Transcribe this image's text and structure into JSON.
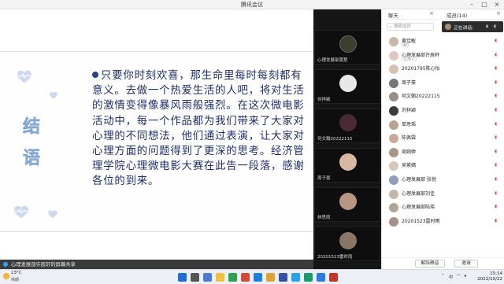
{
  "window": {
    "title": "腾讯会议"
  },
  "slide": {
    "vertical_title": [
      "结",
      "语"
    ],
    "paragraph": "只要你时刻欢喜，那生命里每时每刻都有意义。去做一个热爱生活的人吧，将对生活的激情变得像暴风雨般强烈。在这次微电影活动中，每一个作品都为我们带来了大家对心理的不同想法，他们通过表演，让大家对心理方面的问题得到了更深的思考。经济管理学院心理微电影大赛在此告一段落，感谢各位的到来。"
  },
  "share_bar": {
    "label": "心理发展部许辰轩的屏幕共享"
  },
  "videos": [
    {
      "name": "心理发展部黄楚"
    },
    {
      "name": "刘祥颖"
    },
    {
      "name": "何文翰20222115"
    },
    {
      "name": "周子豪"
    },
    {
      "name": "林思雨"
    },
    {
      "name": "20201523雷时雨"
    }
  ],
  "panel": {
    "tab_chat": "聊天",
    "tab_members": "成员(14)",
    "search_placeholder": "搜索成员",
    "speaking_label": "正在讲话:",
    "members": [
      {
        "name": "黄佳敏",
        "sub": "(我)"
      },
      {
        "name": "心理发展部许辰轩",
        "sub": "(主持人)"
      },
      {
        "name": "20201795陈心怡",
        "sub": ""
      },
      {
        "name": "周子豪",
        "sub": ""
      },
      {
        "name": "何文翰20222115",
        "sub": ""
      },
      {
        "name": "刘祥颖",
        "sub": ""
      },
      {
        "name": "单思瑶",
        "sub": ""
      },
      {
        "name": "陈佩霖",
        "sub": ""
      },
      {
        "name": "周婉婷",
        "sub": ""
      },
      {
        "name": "吴紫嫣",
        "sub": ""
      },
      {
        "name": "心理发展部 张悦",
        "sub": ""
      },
      {
        "name": "心理发展部刘佳",
        "sub": ""
      },
      {
        "name": "心理发展部陆瑶",
        "sub": ""
      },
      {
        "name": "20201523雷时雨",
        "sub": ""
      }
    ],
    "btn_mute_all": "解除静音",
    "btn_invite": "邀请"
  },
  "taskbar": {
    "temp": "23°C",
    "weather": "晴朗",
    "time": "15:14",
    "date": "2022/10/22",
    "lang": "中"
  },
  "colors": {
    "slide_text": "#1d2f6a",
    "accent_blue": "#2ba3ff",
    "heart": "#cbdaf0"
  }
}
